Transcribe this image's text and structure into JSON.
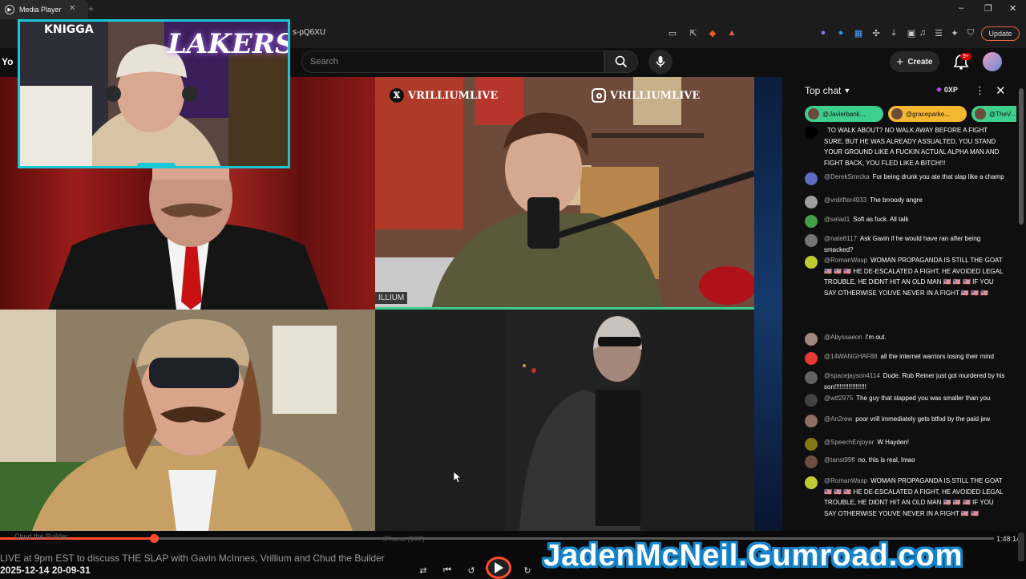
{
  "browser": {
    "tab_title": "Media Player",
    "url_fragment": "s-pQ6XU",
    "update_label": "Update"
  },
  "youtube": {
    "logo_text": "Yo",
    "search_placeholder": "Search",
    "create_label": "Create",
    "notification_badge": "9+"
  },
  "video": {
    "handle_x": "VRILLIUMLIVE",
    "handle_ig": "VRILLIUMLIVE",
    "name_tag": "ILLIUM",
    "lakers_text": "LAKERS",
    "jersey_text": "KNIGGA"
  },
  "chat": {
    "title": "Top chat",
    "xp": "0XP",
    "pinned": [
      {
        "name": "@Javierbank...",
        "color": "#3ecf8e"
      },
      {
        "name": "@graceparke...",
        "color": "#f5b731"
      },
      {
        "name": "@TheV...",
        "color": "#3ecf8e"
      }
    ],
    "messages": [
      {
        "author": "",
        "text": "TO WALK ABOUT? NO WALK AWAY BEFORE A FIGHT SURE, BUT HE WAS ALREADY ASSUALTED, YOU STAND YOUR GROUND LIKE A FUCKIN ACTUAL ALPHA MAN AND FIGHT BACK, YOU FLED LIKE A BITCH!!!",
        "avatar": "#000000"
      },
      {
        "author": "@DerekSmrcka",
        "text": "For being drunk you ate that slap like a champ",
        "avatar": "#5c6bc0"
      },
      {
        "author": "@vrdrifter4933",
        "text": "The brroody angre",
        "avatar": "#9e9e9e"
      },
      {
        "author": "@setad1",
        "text": "Soft as fuck. All talk",
        "avatar": "#43a047"
      },
      {
        "author": "@nate8117",
        "text": "Ask Gavin if he would have ran after being smacked?",
        "avatar": "#757575"
      },
      {
        "author": "@RomanWasp",
        "text": "WOMAN PROPAGANDA IS STILL THE GOAT 🇺🇸 🇺🇸 🇺🇸 HE DE-ESCALATED A FIGHT, HE AVOIDED LEGAL TROUBLE, HE DIDNT HIT AN OLD MAN 🇺🇸 🇺🇸 🇺🇸 IF YOU SAY OTHERWISE YOUVE NEVER IN A FIGHT 🇺🇸 🇺🇸 🇺🇸",
        "avatar": "#c0ca33"
      },
      {
        "author": "@Abyssaeon",
        "text": "I'm out.",
        "avatar": "#a1887f"
      },
      {
        "author": "@14WANGHAF88",
        "text": "all the internet warriors losing their mind",
        "avatar": "#e53935"
      },
      {
        "author": "@spacejayson4114",
        "text": "Dude. Rob Reiner just got murdered by his son!!!!!!!!!!!!!!!!!!",
        "avatar": "#616161"
      },
      {
        "author": "@wtf2975",
        "text": "The guy that slapped you was smaller than you",
        "avatar": "#424242"
      },
      {
        "author": "@An2rew",
        "text": "poor vrill immediately gets btfod by the paid jew",
        "avatar": "#8d6e63"
      },
      {
        "author": "@SpeechEnjoyer",
        "text": "W Hayden!",
        "avatar": "#827717"
      },
      {
        "author": "@tanst99fl",
        "text": "no, this is real, lmao",
        "avatar": "#6d4c41"
      },
      {
        "author": "@RomanWasp",
        "text": "WOMAN PROPAGANDA IS STILL THE GOAT 🇺🇸 🇺🇸 🇺🇸 HE DE-ESCALATED A FIGHT, HE AVOIDED LEGAL TROUBLE, HE DIDNT HIT AN OLD MAN 🇺🇸 🇺🇸 🇺🇸 IF YOU SAY OTHERWISE YOUVE NEVER IN A FIGHT 🇺🇸 🇺🇸",
        "avatar": "#c0ca33"
      }
    ]
  },
  "player": {
    "duration": "1:48:14",
    "progress": 0.155,
    "chapter_left": "Chud the Builder",
    "chapter_mid": "iPhone (107)",
    "title": "LIVE at 9pm EST to discuss THE SLAP with Gavin McInnes, Vrillium and Chud the Builder",
    "timestamp": "2025-12-14 20-09-31",
    "watermark": "JadenMcNeil.Gumroad.com"
  }
}
